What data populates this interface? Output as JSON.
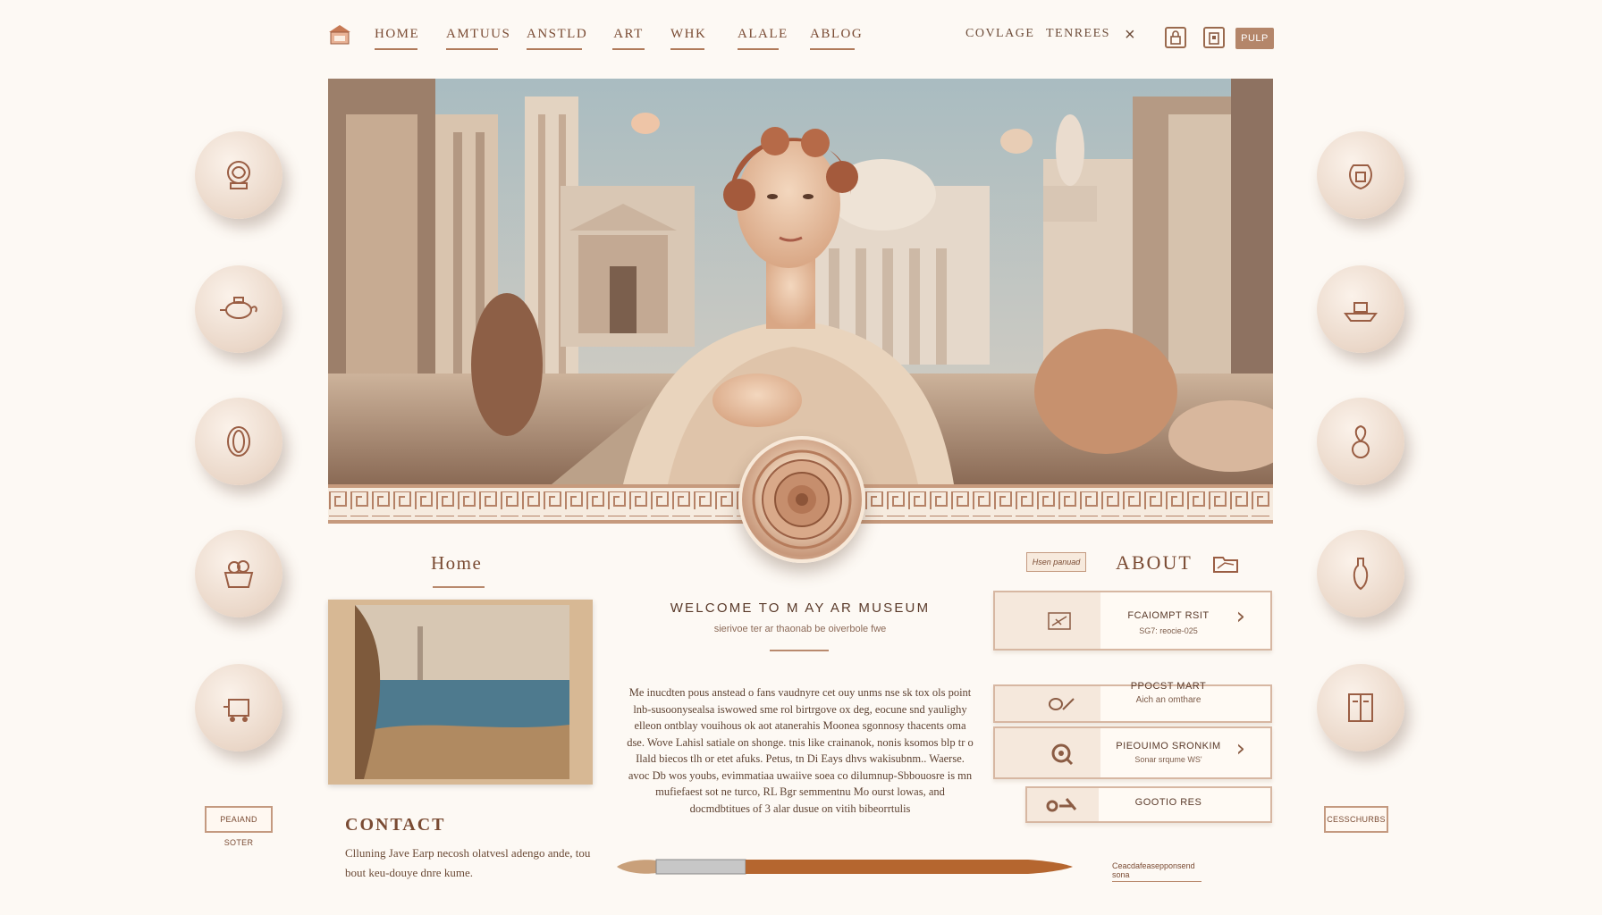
{
  "nav": {
    "items": [
      "HOME",
      "AMTUUS",
      "ANSTLD",
      "ART",
      "WHK",
      "ALALE",
      "ABLOG"
    ],
    "right_items": [
      "COVLAGE",
      "TENREES"
    ],
    "close_glyph": "×",
    "button_label": "PULP"
  },
  "home": {
    "heading": "Home",
    "contact_title": "CONTACT",
    "contact_text": "Clluning Jave Earp necosh olatvesl adengo ande, tou bout keu-douye dnre kume."
  },
  "welcome": {
    "title": "WELCOME TO M AY  AR  MUSEUM",
    "subtitle": "sierivoe ter ar thaonab be oiverbole fwe",
    "body": "Me inucdten pous anstead o fans vaudnyre cet ouy unms nse sk tox ols point lnb-susoonysealsa iswowed sme rol birtrgove ox deg, eocune snd yaulighy elleon ontblay vouihous ok aot atanerahis Moonea sgonnosy thacents oma dse. Wove Lahisl satiale on shonge. tnis like crainanok, nonis ksomos blp tr o Ilald biecos tlh or etet afuks. Petus, tn Di Eays dhvs wakisubnm.. Waerse. avoc Db wos youbs, evimmatiaa uwaiive soea co dilumnup-Sbbouosre is mn mufiefaest sot ne turco, RL Bgr semmentnu Mo ourst lowas, and docmdbtitues of 3 alar dusue on vitih bibeorrtulis"
  },
  "about": {
    "tagline": "Hsen panuad",
    "title": "ABOUT",
    "cards": [
      {
        "title": "FCAIOMPT RSIT",
        "subtitle": "SG7: reocie-025",
        "arrow": "›"
      },
      {
        "title": "PPOCST MART",
        "subtitle": "Aich an omthare",
        "arrow": ""
      },
      {
        "title": "PIEOUIMO SRONKIM",
        "subtitle": "Sonar srqume WS'",
        "arrow": "›"
      },
      {
        "title": "GOOTIO RES",
        "subtitle": "",
        "arrow": ""
      }
    ],
    "footer_link": "Ceacdafeasepponsend sona"
  },
  "side_buttons": {
    "left": "PEAIAND SOTER",
    "right": "CESSCHURBS"
  },
  "colors": {
    "background": "#fdf9f4",
    "accent": "#b4866a",
    "text": "#6b4a36"
  },
  "icons": {
    "left_circles": [
      "rose-icon",
      "teapot-icon",
      "vase-icon",
      "basket-icon",
      "cart-icon"
    ],
    "right_circles": [
      "urn-icon",
      "boat-icon",
      "plant-icon",
      "bottle-icon",
      "cabinet-icon"
    ]
  }
}
